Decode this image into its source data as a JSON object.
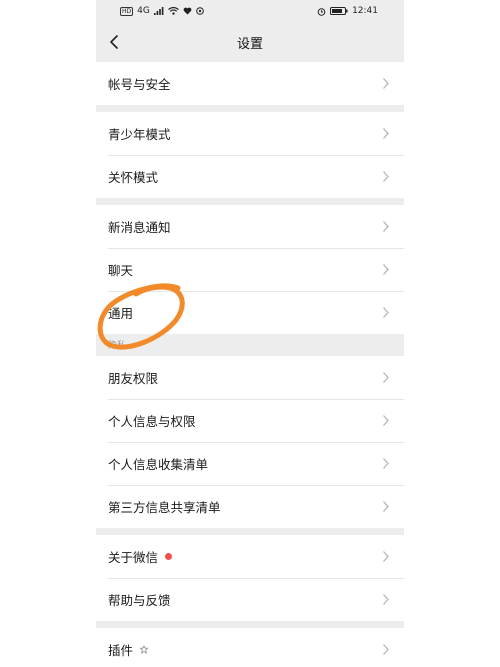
{
  "status_bar": {
    "network_box": "HD",
    "signal_text": "4G",
    "time": "12:41"
  },
  "header": {
    "title": "设置"
  },
  "groups": [
    {
      "items": [
        {
          "label": "帐号与安全"
        }
      ]
    },
    {
      "items": [
        {
          "label": "青少年模式"
        },
        {
          "label": "关怀模式"
        }
      ]
    },
    {
      "items": [
        {
          "label": "新消息通知"
        },
        {
          "label": "聊天"
        },
        {
          "label": "通用"
        }
      ]
    },
    {
      "section_label": "隐私",
      "items": [
        {
          "label": "朋友权限"
        },
        {
          "label": "个人信息与权限"
        },
        {
          "label": "个人信息收集清单"
        },
        {
          "label": "第三方信息共享清单"
        }
      ]
    },
    {
      "items": [
        {
          "label": "关于微信"
        },
        {
          "label": "帮助与反馈"
        }
      ]
    },
    {
      "items": [
        {
          "label": "插件"
        }
      ]
    }
  ],
  "colors": {
    "annotation": "#f28a2a",
    "badge": "#f25050",
    "background": "#ededed"
  },
  "icons": {
    "back": "chevron-left-icon",
    "row": "chevron-right-icon",
    "plugin": "plugin-icon"
  }
}
